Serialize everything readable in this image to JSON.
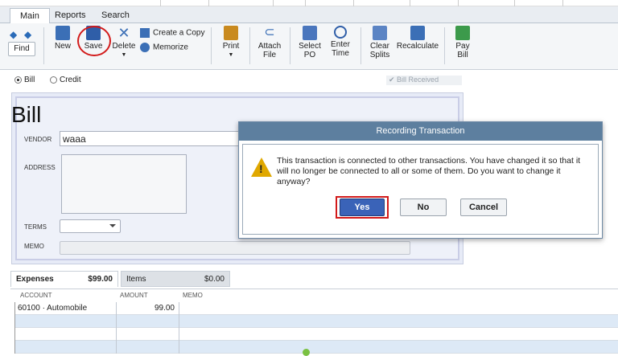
{
  "tabs": [
    "Main",
    "Reports",
    "Search"
  ],
  "toolbar": {
    "find": "Find",
    "new": "New",
    "save": "Save",
    "delete": "Delete",
    "create_copy": "Create a Copy",
    "memorize": "Memorize",
    "print": "Print",
    "attach_file": [
      "Attach",
      "File"
    ],
    "select_po": [
      "Select",
      "PO"
    ],
    "enter_time": [
      "Enter",
      "Time"
    ],
    "clear_splits": [
      "Clear",
      "Splits"
    ],
    "recalculate": "Recalculate",
    "pay_bill": [
      "Pay",
      "Bill"
    ]
  },
  "radios": {
    "bill": "Bill",
    "credit": "Credit",
    "bill_received": "Bill Received"
  },
  "form": {
    "title": "Bill",
    "vendor_label": "VENDOR",
    "vendor_value": "waaa",
    "address_label": "ADDRESS",
    "terms_label": "TERMS",
    "memo_label": "MEMO"
  },
  "lower_tabs": {
    "expenses_label": "Expenses",
    "expenses_value": "$99.00",
    "items_label": "Items",
    "items_value": "$0.00"
  },
  "grid": {
    "headers": [
      "ACCOUNT",
      "AMOUNT",
      "MEMO"
    ],
    "rows": [
      {
        "account": "60100 · Automobile",
        "amount": "99.00",
        "memo": ""
      }
    ]
  },
  "dialog": {
    "title": "Recording Transaction",
    "message": "This transaction is connected to other transactions. You have changed it so that it will no longer be connected to all or some of them. Do you want to change it anyway?",
    "yes": "Yes",
    "no": "No",
    "cancel": "Cancel"
  }
}
